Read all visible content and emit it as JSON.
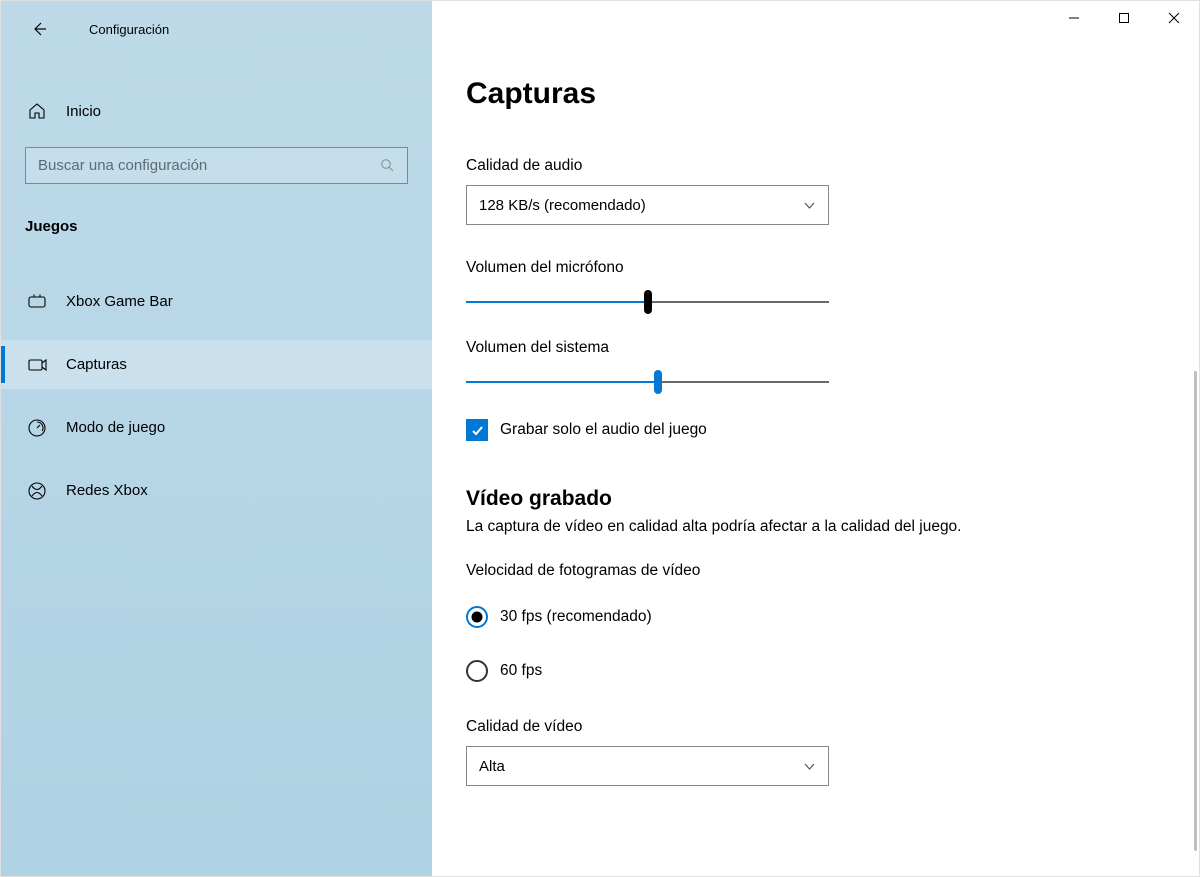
{
  "window": {
    "title": "Configuración"
  },
  "sidebar": {
    "home_label": "Inicio",
    "search_placeholder": "Buscar una configuración",
    "category": "Juegos",
    "items": [
      {
        "id": "xbox-game-bar",
        "label": "Xbox Game Bar",
        "selected": false
      },
      {
        "id": "capturas",
        "label": "Capturas",
        "selected": true
      },
      {
        "id": "modo-juego",
        "label": "Modo de juego",
        "selected": false
      },
      {
        "id": "redes-xbox",
        "label": "Redes Xbox",
        "selected": false
      }
    ]
  },
  "main": {
    "title": "Capturas",
    "audio_quality": {
      "label": "Calidad de audio",
      "value": "128 KB/s (recomendado)"
    },
    "mic_volume": {
      "label": "Volumen del micrófono"
    },
    "sys_volume": {
      "label": "Volumen del sistema"
    },
    "record_game_audio": {
      "label": "Grabar solo el audio del juego",
      "checked": true
    },
    "recorded_video": {
      "heading": "Vídeo grabado",
      "description": "La captura de vídeo en calidad alta podría afectar a la calidad del juego."
    },
    "frame_rate": {
      "label": "Velocidad de fotogramas de vídeo",
      "options": [
        {
          "label": "30 fps (recomendado)",
          "selected": true
        },
        {
          "label": "60 fps",
          "selected": false
        }
      ]
    },
    "video_quality": {
      "label": "Calidad de vídeo",
      "value": "Alta"
    }
  }
}
